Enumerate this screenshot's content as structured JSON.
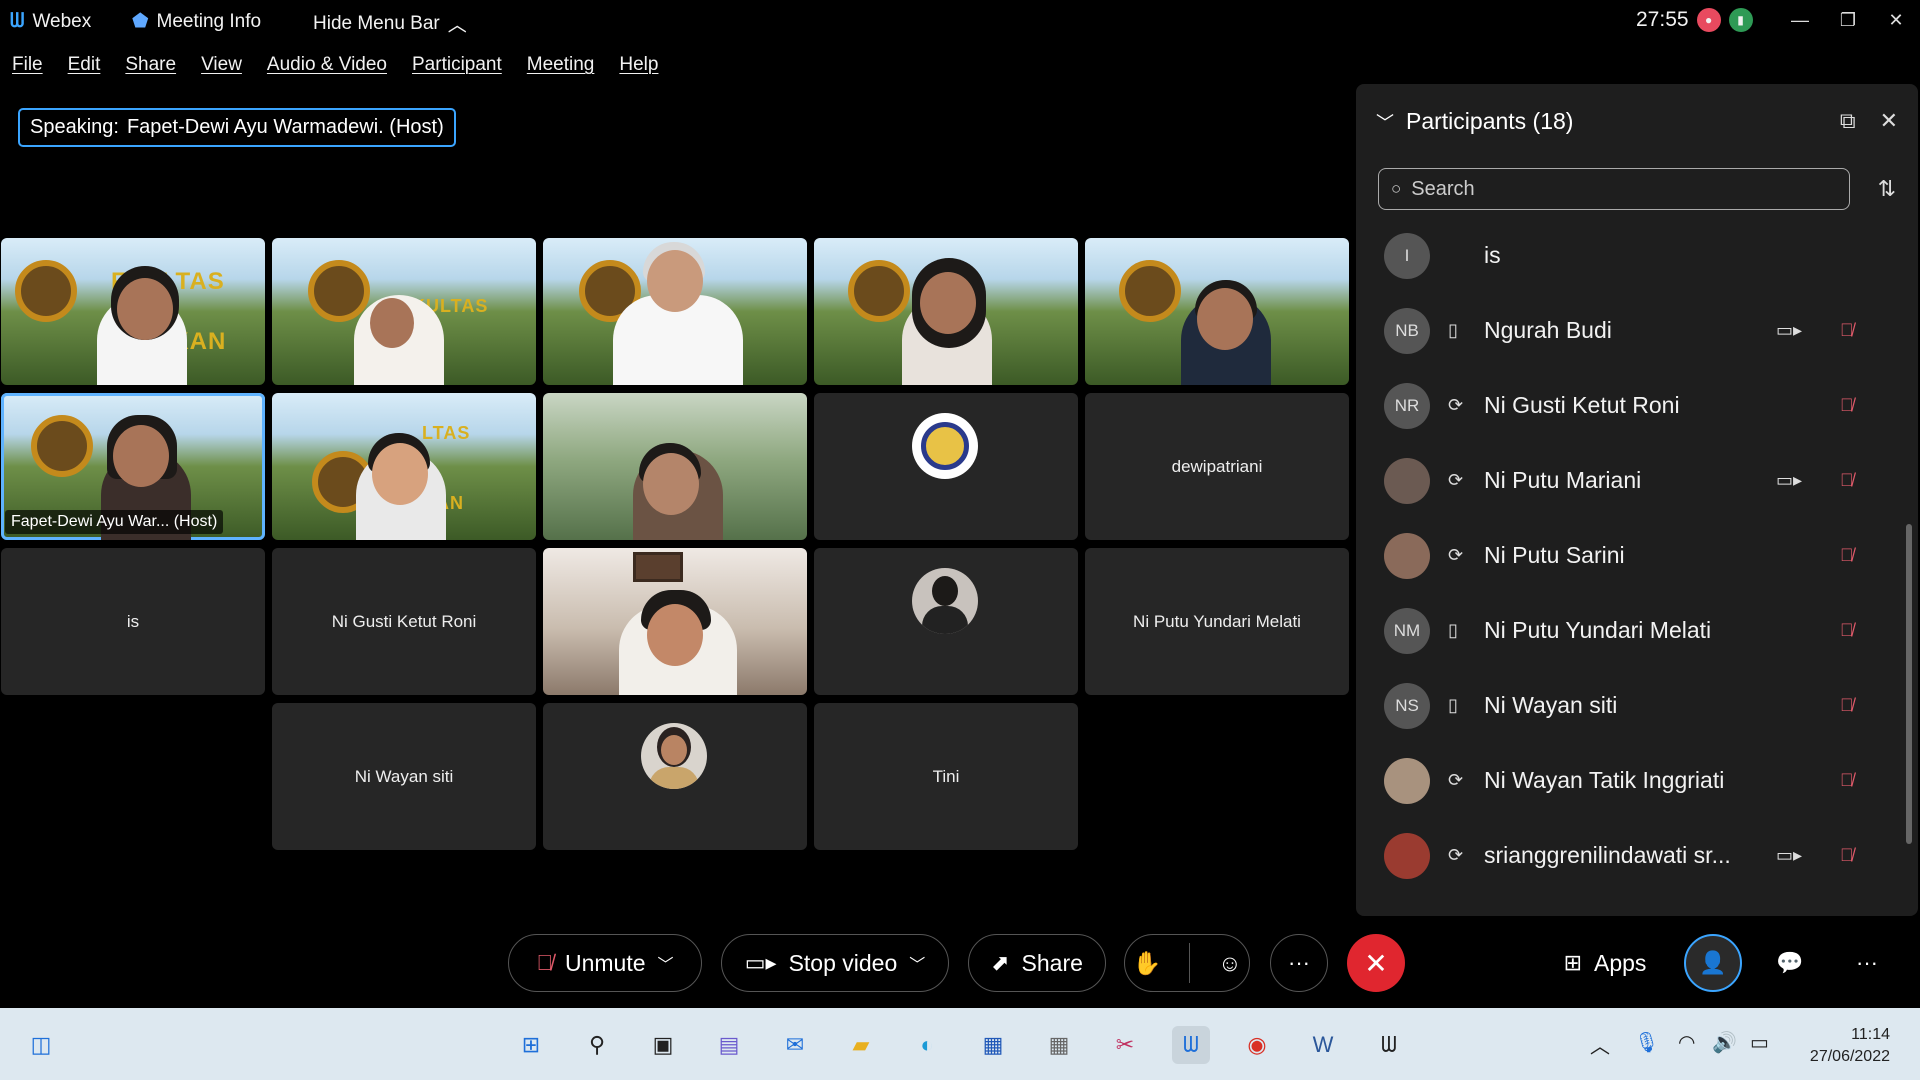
{
  "titlebar": {
    "app_name": "Webex",
    "meeting_info": "Meeting Info",
    "hide_menu": "Hide Menu Bar",
    "timer": "27:55"
  },
  "menu": [
    "File",
    "Edit",
    "Share",
    "View",
    "Audio & Video",
    "Participant",
    "Meeting",
    "Help"
  ],
  "speaking": {
    "prefix": "Speaking:",
    "name": "Fapet-Dewi Ayu Warmadewi. (Host)"
  },
  "tiles": {
    "host_label": "Fapet-Dewi Ayu War... (Host)",
    "is": "is",
    "ni_gusti": "Ni Gusti Ketut Roni",
    "dewipatriani": "dewipatriani",
    "yundari": "Ni Putu Yundari Melati",
    "wayan_siti": "Ni Wayan siti",
    "tini": "Tini",
    "sign_text": "FAKULTAS PETERNAKAN"
  },
  "participants": {
    "title": "Participants (18)",
    "search_placeholder": "Search",
    "rows": [
      {
        "initials": "I",
        "name": "is",
        "device": "",
        "camera": false
      },
      {
        "initials": "NB",
        "name": "Ngurah Budi",
        "device": "phone",
        "camera": true
      },
      {
        "initials": "NR",
        "name": "Ni Gusti Ketut Roni",
        "device": "sync",
        "camera": false
      },
      {
        "initials": "",
        "name": "Ni Putu Mariani",
        "device": "sync",
        "camera": true
      },
      {
        "initials": "",
        "name": "Ni Putu Sarini",
        "device": "sync",
        "camera": false
      },
      {
        "initials": "NM",
        "name": "Ni Putu Yundari Melati",
        "device": "phone",
        "camera": false
      },
      {
        "initials": "NS",
        "name": "Ni Wayan siti",
        "device": "phone",
        "camera": false
      },
      {
        "initials": "",
        "name": "Ni Wayan Tatik Inggriati",
        "device": "sync",
        "camera": false
      },
      {
        "initials": "",
        "name": "srianggrenilindawati sr...",
        "device": "sync",
        "camera": true
      }
    ]
  },
  "controls": {
    "unmute": "Unmute",
    "stop_video": "Stop video",
    "share": "Share",
    "apps": "Apps"
  },
  "taskbar": {
    "time": "11:14",
    "date": "27/06/2022"
  },
  "colors": {
    "accent": "#3ba5ff",
    "leave": "#e0262f",
    "panel": "#1e1e1e",
    "tile": "#262626"
  }
}
